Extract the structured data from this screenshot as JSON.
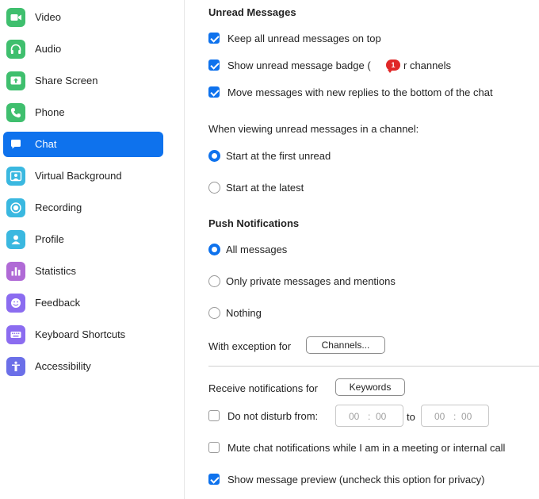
{
  "sidebar": {
    "items": [
      {
        "label": "Video",
        "icon": "video-camera-icon",
        "color": "#3fbf6e"
      },
      {
        "label": "Audio",
        "icon": "headphones-icon",
        "color": "#3fbf6e"
      },
      {
        "label": "Share Screen",
        "icon": "share-screen-icon",
        "color": "#3fbf6e"
      },
      {
        "label": "Phone",
        "icon": "phone-icon",
        "color": "#3fbf6e"
      },
      {
        "label": "Chat",
        "icon": "chat-bubble-icon",
        "color": "#0e72ed"
      },
      {
        "label": "Virtual Background",
        "icon": "person-background-icon",
        "color": "#3ab8e0"
      },
      {
        "label": "Recording",
        "icon": "record-icon",
        "color": "#3ab8e0"
      },
      {
        "label": "Profile",
        "icon": "person-icon",
        "color": "#3ab8e0"
      },
      {
        "label": "Statistics",
        "icon": "bar-chart-icon",
        "color": "#b06ad6"
      },
      {
        "label": "Feedback",
        "icon": "smiley-icon",
        "color": "#8b6cf0"
      },
      {
        "label": "Keyboard Shortcuts",
        "icon": "keyboard-icon",
        "color": "#8b6cf0"
      },
      {
        "label": "Accessibility",
        "icon": "accessibility-icon",
        "color": "#6b6fe8"
      }
    ],
    "active_label": "Chat",
    "accent_color": "#0e72ed"
  },
  "unread": {
    "title": "Unread Messages",
    "keep_on_top": {
      "label": "Keep all unread messages on top",
      "checked": true
    },
    "show_badge": {
      "label_before": "Show unread message badge (",
      "badge_count": "1",
      "label_after": "r channels",
      "checked": true
    },
    "move_replies": {
      "label": "Move messages with new replies to the bottom of the chat",
      "checked": true
    },
    "viewing_prompt": "When viewing unread messages in a channel:",
    "start_first": {
      "label": "Start at the first unread",
      "selected": true
    },
    "start_latest": {
      "label": "Start at the latest",
      "selected": false
    }
  },
  "push": {
    "title": "Push Notifications",
    "all": {
      "label": "All messages",
      "selected": true
    },
    "private": {
      "label": "Only private messages and mentions",
      "selected": false
    },
    "nothing": {
      "label": "Nothing",
      "selected": false
    },
    "exception_label": "With exception for",
    "channels_button": "Channels..."
  },
  "notify": {
    "receive_label": "Receive notifications for",
    "keywords_button": "Keywords",
    "dnd": {
      "label": "Do not disturb from:",
      "checked": false,
      "from_hh": "00",
      "from_mm": "00",
      "to_label": "to",
      "to_hh": "00",
      "to_mm": "00"
    },
    "mute": {
      "label": "Mute chat notifications while I am in a meeting or internal call",
      "checked": false
    },
    "preview": {
      "label": "Show message preview (uncheck this option for privacy)",
      "checked": true
    }
  }
}
